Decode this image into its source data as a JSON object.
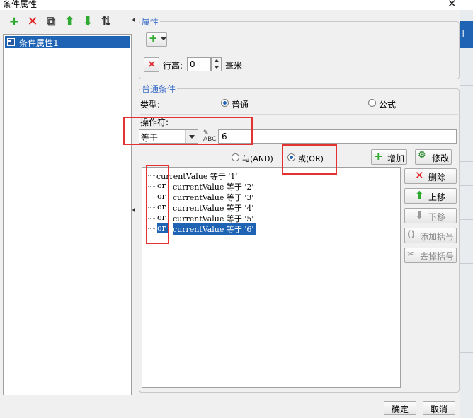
{
  "window": {
    "title": "条件属性",
    "close": "✕"
  },
  "left": {
    "toolbar": [
      {
        "name": "add-icon",
        "glyph": "+",
        "color": "#2eaa2e"
      },
      {
        "name": "delete-icon",
        "glyph": "✕",
        "color": "#e02020"
      },
      {
        "name": "copy-icon",
        "glyph": "⧉",
        "color": "#444444"
      },
      {
        "name": "move-up-icon",
        "glyph": "⬆",
        "color": "#2eaa2e"
      },
      {
        "name": "move-down-icon",
        "glyph": "⬇",
        "color": "#2eaa2e"
      },
      {
        "name": "sort-az-icon",
        "glyph": "⇅",
        "color": "#333333"
      }
    ],
    "items": [
      {
        "label": "条件属性1"
      }
    ]
  },
  "properties": {
    "title": "属性",
    "add_glyph": "+",
    "row_height_label": "行高:",
    "row_height_value": "0",
    "row_height_unit": "毫米"
  },
  "general": {
    "title": "普通条件",
    "type_label": "类型:",
    "type_options": [
      "普通",
      "公式"
    ],
    "type_selected": "普通",
    "operator_label": "操作符:",
    "operator_value": "等于",
    "value_input": "6",
    "logic_options": [
      "与(AND)",
      "或(OR)"
    ],
    "logic_selected": "或(OR)",
    "add_label": "增加",
    "modify_label": "修改"
  },
  "conditions": [
    {
      "op": "",
      "text": "currentValue 等于 '1'"
    },
    {
      "op": "or",
      "text": "currentValue 等于 '2'"
    },
    {
      "op": "or",
      "text": "currentValue 等于 '3'"
    },
    {
      "op": "or",
      "text": "currentValue 等于 '4'"
    },
    {
      "op": "or",
      "text": "currentValue 等于 '5'"
    },
    {
      "op": "or",
      "text": "currentValue 等于 '6'"
    }
  ],
  "side_buttons": {
    "delete": "删除",
    "move_up": "上移",
    "move_down": "下移",
    "add_bracket": "添加括号",
    "remove_bracket": "去掉括号"
  },
  "footer": {
    "ok": "确定",
    "cancel": "取消"
  },
  "colors": {
    "accent": "#1f63b5",
    "group_title": "#3a6cc8",
    "annotation": "#e23232"
  }
}
